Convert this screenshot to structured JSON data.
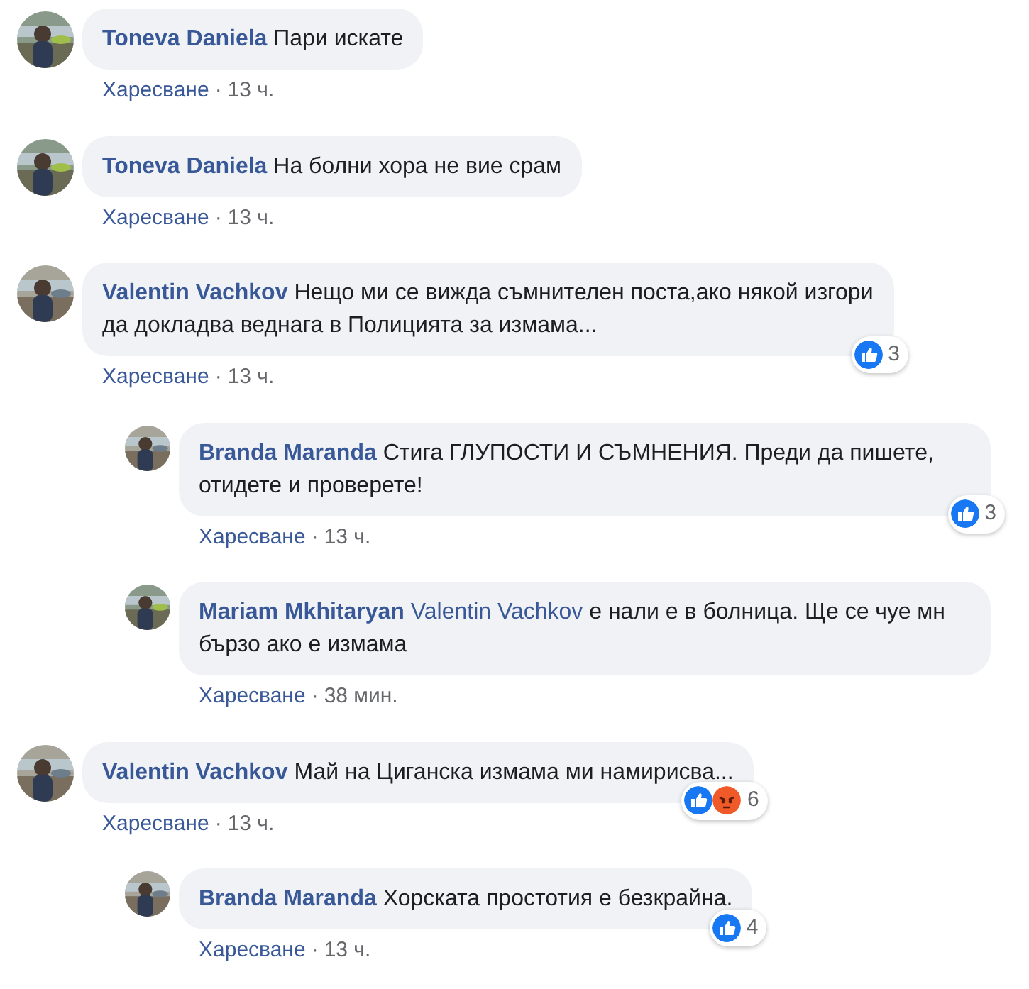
{
  "comments": [
    {
      "author": "Toneva Daniela",
      "text": "Пари искате",
      "like": "Харесване",
      "sep": "·",
      "time": "13 ч."
    },
    {
      "author": "Toneva Daniela",
      "text": "На болни хора не вие срам",
      "like": "Харесване",
      "sep": "·",
      "time": "13 ч."
    },
    {
      "author": "Valentin Vachkov",
      "text": "Нещо ми се вижда съмнителен поста,ако някой изгори да докладва веднага в Полицията за измама...",
      "like": "Харесване",
      "sep": "·",
      "time": "13 ч.",
      "reactions": [
        {
          "kind": "like"
        }
      ],
      "count": "3",
      "children": [
        {
          "author": "Branda Maranda",
          "text": "Стига ГЛУПОСТИ И СЪМНЕНИЯ. Преди да пишете, отидете и проверете!",
          "like": "Харесване",
          "sep": "·",
          "time": "13 ч.",
          "reactions": [
            {
              "kind": "like"
            }
          ],
          "count": "3"
        },
        {
          "author": "Mariam Mkhitaryan",
          "mention": "Valentin Vachkov",
          "text": "е нали е в болница. Ще се чуе мн бързо ако е измама",
          "like": "Харесване",
          "sep": "·",
          "time": "38 мин."
        }
      ]
    },
    {
      "author": "Valentin Vachkov",
      "text": "Май на Циганска измама ми намирисва...",
      "like": "Харесване",
      "sep": "·",
      "time": "13 ч.",
      "reactions": [
        {
          "kind": "like"
        },
        {
          "kind": "angry"
        }
      ],
      "count": "6",
      "children": [
        {
          "author": "Branda Maranda",
          "text": "Хорската простотия е безкрайна.",
          "like": "Харесване",
          "sep": "·",
          "time": "13 ч.",
          "reactions": [
            {
              "kind": "like"
            }
          ],
          "count": "4"
        }
      ]
    }
  ]
}
